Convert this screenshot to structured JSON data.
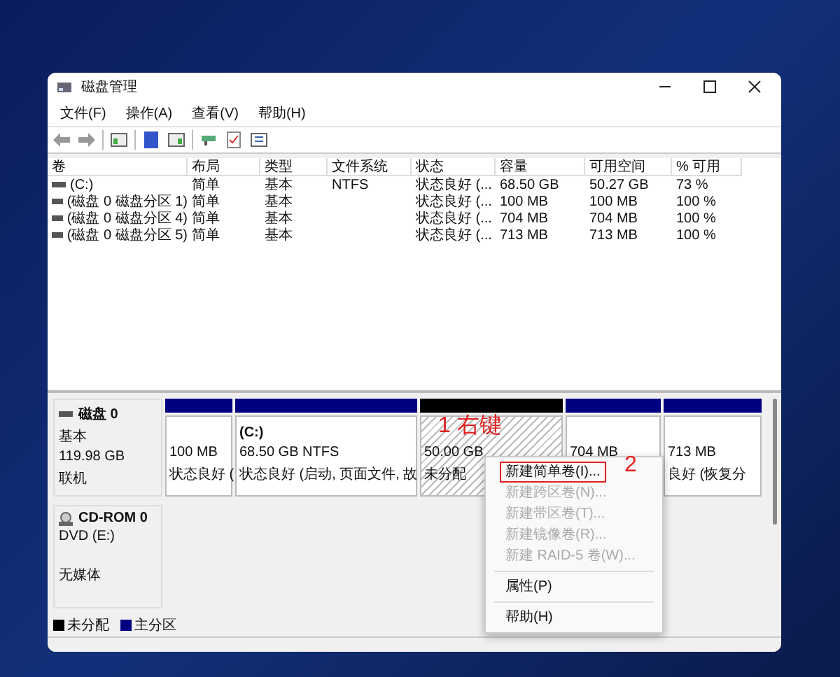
{
  "window": {
    "title": "磁盘管理"
  },
  "menu": [
    "文件(F)",
    "操作(A)",
    "查看(V)",
    "帮助(H)"
  ],
  "table": {
    "columns": [
      "卷",
      "布局",
      "类型",
      "文件系统",
      "状态",
      "容量",
      "可用空间",
      "% 可用"
    ],
    "rows": [
      [
        "(C:)",
        "简单",
        "基本",
        "NTFS",
        "状态良好 (...",
        "68.50 GB",
        "50.27 GB",
        "73 %"
      ],
      [
        "(磁盘 0 磁盘分区 1)",
        "简单",
        "基本",
        "",
        "状态良好 (...",
        "100 MB",
        "100 MB",
        "100 %"
      ],
      [
        "(磁盘 0 磁盘分区 4)",
        "简单",
        "基本",
        "",
        "状态良好 (...",
        "704 MB",
        "704 MB",
        "100 %"
      ],
      [
        "(磁盘 0 磁盘分区 5)",
        "简单",
        "基本",
        "",
        "状态良好 (...",
        "713 MB",
        "713 MB",
        "100 %"
      ]
    ]
  },
  "disks": [
    {
      "kind": "disk",
      "name": "磁盘 0",
      "lines": [
        "基本",
        "119.98 GB",
        "联机"
      ],
      "partitions": [
        {
          "kind": "primary",
          "lines": [
            "100 MB",
            "状态良好 ("
          ]
        },
        {
          "kind": "primary",
          "title": "(C:)",
          "lines": [
            "68.50 GB NTFS",
            "状态良好 (启动, 页面文件, 故"
          ]
        },
        {
          "kind": "unallocated",
          "lines": [
            "50.00 GB",
            "未分配"
          ]
        },
        {
          "kind": "primary",
          "lines": [
            "704 MB"
          ]
        },
        {
          "kind": "primary",
          "lines": [
            "713 MB",
            "良好 (恢复分"
          ]
        }
      ]
    },
    {
      "kind": "cdrom",
      "name": "CD-ROM 0",
      "lines": [
        "DVD (E:)",
        "无媒体"
      ]
    }
  ],
  "legend": [
    {
      "label": "未分配",
      "color": "#000000"
    },
    {
      "label": "主分区",
      "color": "#000080"
    }
  ],
  "context_menu": [
    {
      "label": "新建简单卷(I)...",
      "disabled": false,
      "highlighted": true
    },
    {
      "label": "新建跨区卷(N)...",
      "disabled": true,
      "highlighted": false
    },
    {
      "label": "新建带区卷(T)...",
      "disabled": true,
      "highlighted": false
    },
    {
      "label": "新建镜像卷(R)...",
      "disabled": true,
      "highlighted": false
    },
    {
      "label": "新建 RAID-5 卷(W)...",
      "disabled": true,
      "highlighted": false
    },
    {
      "kind": "separator"
    },
    {
      "label": "属性(P)",
      "disabled": false,
      "highlighted": false
    },
    {
      "kind": "separator"
    },
    {
      "label": "帮助(H)",
      "disabled": false,
      "highlighted": false
    }
  ],
  "annotations": [
    {
      "kind": "partition",
      "label": "1 右键"
    },
    {
      "kind": "menu",
      "label": "2"
    }
  ]
}
